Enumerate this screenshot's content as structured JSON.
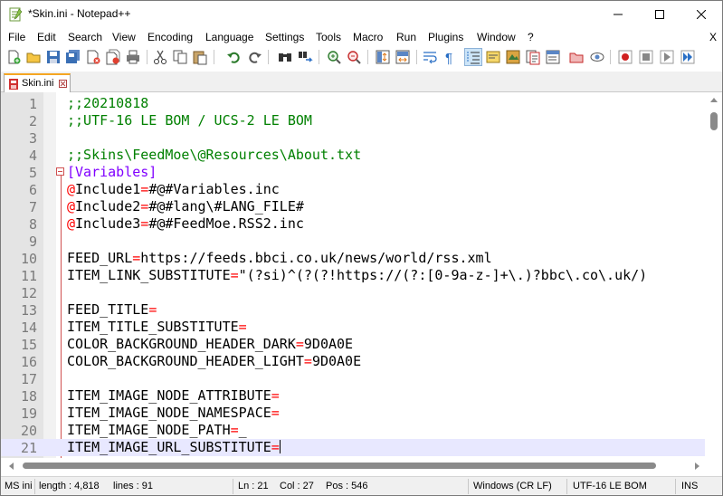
{
  "window": {
    "title": "*Skin.ini - Notepad++"
  },
  "menu": {
    "items": [
      "File",
      "Edit",
      "Search",
      "View",
      "Encoding",
      "Language",
      "Settings",
      "Tools",
      "Macro",
      "Run",
      "Plugins",
      "Window",
      "?"
    ],
    "close_label": "X"
  },
  "tab": {
    "label": "Skin.ini"
  },
  "editor": {
    "lines": [
      {
        "num": "1",
        "parts": [
          {
            "t": ";;20210818",
            "c": "comment"
          }
        ]
      },
      {
        "num": "2",
        "parts": [
          {
            "t": ";;UTF-16 LE BOM / UCS-2 LE BOM",
            "c": "comment"
          }
        ]
      },
      {
        "num": "3",
        "parts": []
      },
      {
        "num": "4",
        "parts": [
          {
            "t": ";;Skins\\FeedMoe\\@Resources\\About.txt",
            "c": "comment"
          }
        ]
      },
      {
        "num": "5",
        "parts": [
          {
            "t": "[Variables]",
            "c": "section"
          }
        ]
      },
      {
        "num": "6",
        "parts": [
          {
            "t": "@",
            "c": "at"
          },
          {
            "t": "Include1",
            "c": "key"
          },
          {
            "t": "=",
            "c": "eq"
          },
          {
            "t": "#@#Variables.inc",
            "c": "val"
          }
        ]
      },
      {
        "num": "7",
        "parts": [
          {
            "t": "@",
            "c": "at"
          },
          {
            "t": "Include2",
            "c": "key"
          },
          {
            "t": "=",
            "c": "eq"
          },
          {
            "t": "#@#lang\\#LANG_FILE#",
            "c": "val"
          }
        ]
      },
      {
        "num": "8",
        "parts": [
          {
            "t": "@",
            "c": "at"
          },
          {
            "t": "Include3",
            "c": "key"
          },
          {
            "t": "=",
            "c": "eq"
          },
          {
            "t": "#@#FeedMoe.RSS2.inc",
            "c": "val"
          }
        ]
      },
      {
        "num": "9",
        "parts": []
      },
      {
        "num": "10",
        "parts": [
          {
            "t": "FEED_URL",
            "c": "key"
          },
          {
            "t": "=",
            "c": "eq"
          },
          {
            "t": "https://feeds.bbci.co.uk/news/world/rss.xml",
            "c": "val"
          }
        ]
      },
      {
        "num": "11",
        "parts": [
          {
            "t": "ITEM_LINK_SUBSTITUTE",
            "c": "key"
          },
          {
            "t": "=",
            "c": "eq"
          },
          {
            "t": "\"(?si)^(?(?!https://(?:[0-9a-z-]+\\.)?bbc\\.co\\.uk/)",
            "c": "val"
          }
        ]
      },
      {
        "num": "12",
        "parts": []
      },
      {
        "num": "13",
        "parts": [
          {
            "t": "FEED_TITLE",
            "c": "key"
          },
          {
            "t": "=",
            "c": "eq"
          }
        ]
      },
      {
        "num": "14",
        "parts": [
          {
            "t": "ITEM_TITLE_SUBSTITUTE",
            "c": "key"
          },
          {
            "t": "=",
            "c": "eq"
          }
        ]
      },
      {
        "num": "15",
        "parts": [
          {
            "t": "COLOR_BACKGROUND_HEADER_DARK",
            "c": "key"
          },
          {
            "t": "=",
            "c": "eq"
          },
          {
            "t": "9D0A0E",
            "c": "val"
          }
        ]
      },
      {
        "num": "16",
        "parts": [
          {
            "t": "COLOR_BACKGROUND_HEADER_LIGHT",
            "c": "key"
          },
          {
            "t": "=",
            "c": "eq"
          },
          {
            "t": "9D0A0E",
            "c": "val"
          }
        ]
      },
      {
        "num": "17",
        "parts": []
      },
      {
        "num": "18",
        "parts": [
          {
            "t": "ITEM_IMAGE_NODE_ATTRIBUTE",
            "c": "key"
          },
          {
            "t": "=",
            "c": "eq"
          }
        ]
      },
      {
        "num": "19",
        "parts": [
          {
            "t": "ITEM_IMAGE_NODE_NAMESPACE",
            "c": "key"
          },
          {
            "t": "=",
            "c": "eq"
          }
        ]
      },
      {
        "num": "20",
        "parts": [
          {
            "t": "ITEM_IMAGE_NODE_PATH",
            "c": "key"
          },
          {
            "t": "=",
            "c": "eq"
          },
          {
            "t": "_",
            "c": "val"
          }
        ]
      },
      {
        "num": "21",
        "parts": [
          {
            "t": "ITEM_IMAGE_URL_SUBSTITUTE",
            "c": "key"
          },
          {
            "t": "=",
            "c": "eq"
          }
        ]
      }
    ],
    "current_line": "21",
    "section_line": "5"
  },
  "status": {
    "file_type": "MS ini",
    "length": "length : 4,818",
    "lines": "lines : 91",
    "ln": "Ln : 21",
    "col": "Col : 27",
    "pos": "Pos : 546",
    "eol": "Windows (CR LF)",
    "encoding": "UTF-16 LE BOM",
    "mode": "INS"
  },
  "colors": {
    "comment": "#008000",
    "section": "#8000ff",
    "operator": "#ff0000",
    "current_line_bg": "#e8e8ff",
    "tab_accent": "#f5a623"
  }
}
